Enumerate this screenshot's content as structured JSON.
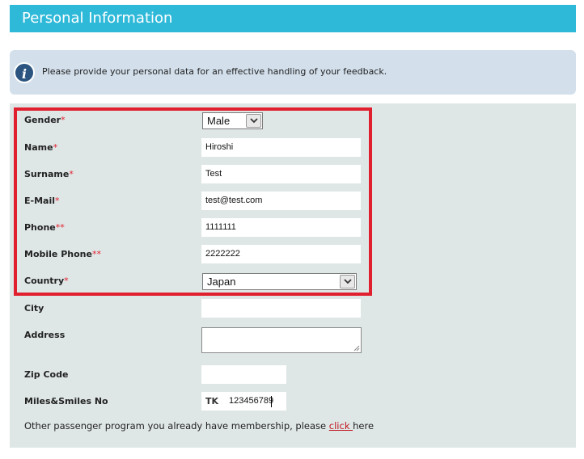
{
  "header": {
    "title": "Personal Information"
  },
  "info": {
    "icon": "info-icon",
    "icon_glyph": "i",
    "text": "Please provide your personal data for an effective handling of your feedback."
  },
  "form": {
    "gender": {
      "label": "Gender",
      "required": "*",
      "value": "Male"
    },
    "name": {
      "label": "Name",
      "required": "*",
      "value": "Hiroshi"
    },
    "surname": {
      "label": "Surname",
      "required": "*",
      "value": "Test"
    },
    "email": {
      "label": "E-Mail",
      "required": "*",
      "value": "test@test.com"
    },
    "phone": {
      "label": "Phone",
      "required": "**",
      "value": "1111111"
    },
    "mobile": {
      "label": "Mobile Phone",
      "required": "**",
      "value": "2222222"
    },
    "country": {
      "label": "Country",
      "required": "*",
      "value": "Japan"
    },
    "city": {
      "label": "City",
      "value": ""
    },
    "address": {
      "label": "Address",
      "value": ""
    },
    "zip": {
      "label": "Zip Code",
      "value": ""
    },
    "miles": {
      "label": "Miles&Smiles No",
      "prefix": "TK",
      "value": "123456789"
    }
  },
  "footer": {
    "text_before": "Other passenger program you already have membership, please ",
    "link": "click ",
    "text_after": "here"
  },
  "colors": {
    "header": "#2fb9d9",
    "info_bg": "#d3e0ec",
    "panel_bg": "#dfe6e6",
    "highlight": "#e0202e",
    "required": "#e0202e"
  }
}
